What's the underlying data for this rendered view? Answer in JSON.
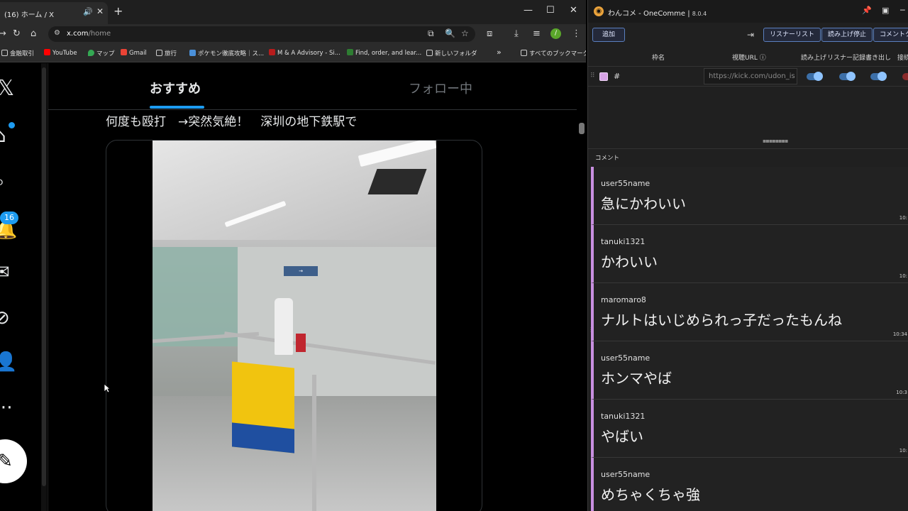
{
  "browser": {
    "tab_title": "(16) ホーム / X",
    "url_domain": "x.com",
    "url_path": "/home",
    "profile_initial": "/",
    "bookmarks": [
      {
        "label": "金融取引",
        "color": "#e8e8e8"
      },
      {
        "label": "YouTube",
        "color": "#ff0000"
      },
      {
        "label": "マップ",
        "color": "#34a853"
      },
      {
        "label": "Gmail",
        "color": "#ea4335"
      },
      {
        "label": "旅行",
        "color": "#cccccc"
      },
      {
        "label": "ポケモン徹底攻略｜ス...",
        "color": "#4a90d9"
      },
      {
        "label": "M & A Advisory - Si...",
        "color": "#b71c1c"
      },
      {
        "label": "Find, order, and lear...",
        "color": "#2e7d32"
      },
      {
        "label": "新しいフォルダ",
        "color": "#cccccc"
      },
      {
        "label": "すべてのブックマーク",
        "color": "#cccccc"
      }
    ]
  },
  "x": {
    "notifications_badge": "16",
    "tabs": [
      "おすすめ",
      "フォロー中"
    ],
    "tweet_text": "何度も殴打　→突然気絶！　深圳の地下鉄駅で",
    "brand_color": "#1d9bf0"
  },
  "onecomme": {
    "title": "わんコメ - OneComme",
    "version": "8.0.4",
    "buttons": {
      "add": "追加",
      "listener_list": "リスナーリスト",
      "read_stop": "読み上げ停止",
      "comment": "コメントク"
    },
    "columns": {
      "name": "枠名",
      "url": "視聴URL",
      "read": "読み上げ",
      "listener": "リスナー記録",
      "export": "書き出し",
      "connect": "接続"
    },
    "source_row": {
      "name": "#",
      "url": "https://kick.com/udon_is"
    },
    "comment_header": "コメント",
    "comments": [
      {
        "user": "user55name",
        "text": "急にかわいい",
        "time": "10:"
      },
      {
        "user": "tanuki1321",
        "text": "かわいい",
        "time": "10:"
      },
      {
        "user": "maromaro8",
        "text": "ナルトはいじめられっ子だったもんね",
        "time": "10:34"
      },
      {
        "user": "user55name",
        "text": "ホンマやば",
        "time": "10:3"
      },
      {
        "user": "tanuki1321",
        "text": "やばい",
        "time": "10:"
      },
      {
        "user": "user55name",
        "text": "めちゃくちゃ強",
        "time": ""
      }
    ],
    "accent_color": "#c88fe0"
  }
}
